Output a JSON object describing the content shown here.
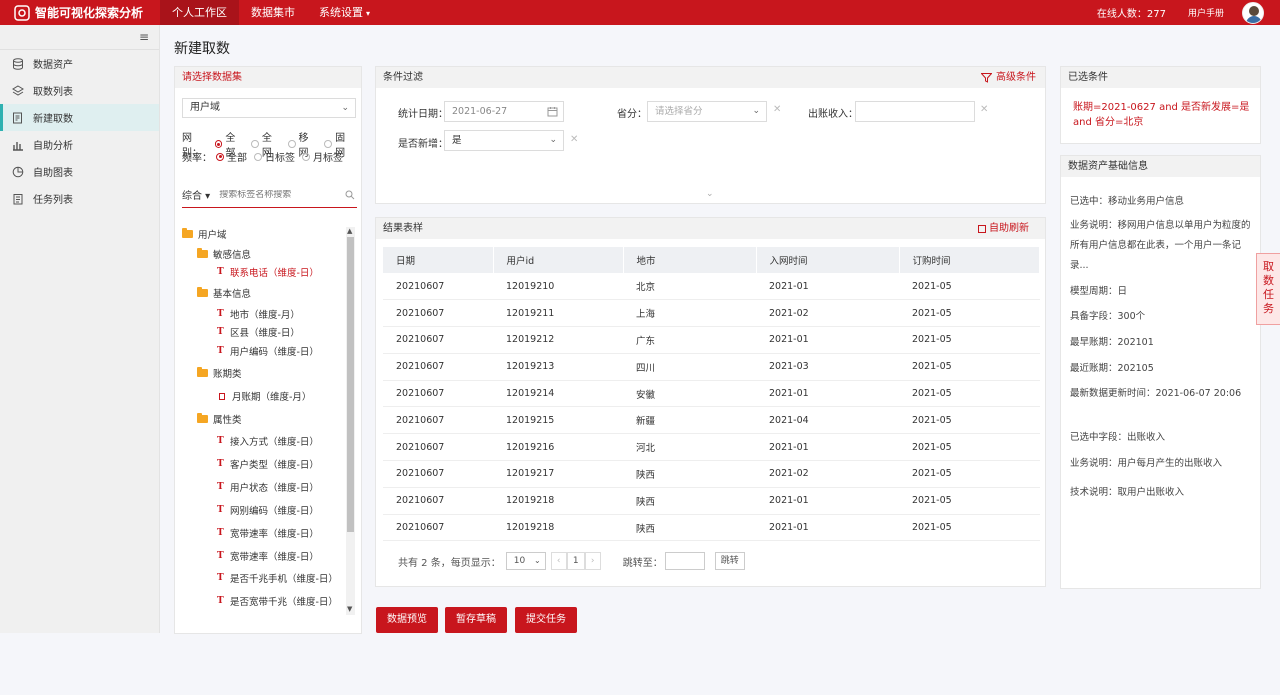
{
  "app": {
    "title": "智能可视化探索分析"
  },
  "topnav": [
    {
      "label": "个人工作区"
    },
    {
      "label": "数据集市"
    },
    {
      "label": "系统设置"
    }
  ],
  "header": {
    "online_label": "在线人数：277",
    "manual": "用户手册"
  },
  "sidebar": {
    "items": [
      {
        "label": "数据资产"
      },
      {
        "label": "取数列表"
      },
      {
        "label": "新建取数"
      },
      {
        "label": "自助分析"
      },
      {
        "label": "自助图表"
      },
      {
        "label": "任务列表"
      }
    ]
  },
  "page": {
    "title": "新建取数"
  },
  "dataset": {
    "title": "请选择数据集",
    "domain": "用户域",
    "net_label": "网别：",
    "net_options": [
      "全部",
      "全网",
      "移网",
      "固网"
    ],
    "freq_label": "频率：",
    "freq_options": [
      "全部",
      "日标签",
      "月标签"
    ],
    "combo": "综合 ▾",
    "search_placeholder": "搜索标签名称搜索",
    "tree": {
      "root": "用户域",
      "n1": "敏感信息",
      "n1a": "联系电话（维度-日）",
      "n2": "基本信息",
      "n2a": "地市（维度-月）",
      "n2b": "区县（维度-日）",
      "n2c": "用户编码（维度-日）",
      "n3": "账期类",
      "n3a": "月账期（维度-月）",
      "n4": "属性类",
      "n4a": "接入方式（维度-日）",
      "n4b": "客户类型（维度-日）",
      "n4c": "用户状态（维度-日）",
      "n4d": "网别编码（维度-日）",
      "n4e": "宽带速率（维度-日）",
      "n4f": "宽带速率（维度-日）",
      "n4g": "是否千兆手机（维度-日）",
      "n4h": "是否宽带千兆（维度-日）"
    }
  },
  "filter": {
    "title": "条件过滤",
    "advanced": "高级条件",
    "date_label": "统计日期：",
    "date_value": "2021-06-27",
    "province_label": "省分：",
    "province_placeholder": "请选择省分",
    "income_label": "出账收入：",
    "income_value": "",
    "new_label": "是否新增：",
    "new_value": "是"
  },
  "result": {
    "title": "结果表样",
    "auto_refresh": "自助刷新",
    "columns": [
      "日期",
      "用户id",
      "地市",
      "入网时间",
      "订购时间"
    ],
    "rows": [
      [
        "20210607",
        "12019210",
        "北京",
        "2021-01",
        "2021-05"
      ],
      [
        "20210607",
        "12019211",
        "上海",
        "2021-02",
        "2021-05"
      ],
      [
        "20210607",
        "12019212",
        "广东",
        "2021-01",
        "2021-05"
      ],
      [
        "20210607",
        "12019213",
        "四川",
        "2021-03",
        "2021-05"
      ],
      [
        "20210607",
        "12019214",
        "安徽",
        "2021-01",
        "2021-05"
      ],
      [
        "20210607",
        "12019215",
        "新疆",
        "2021-04",
        "2021-05"
      ],
      [
        "20210607",
        "12019216",
        "河北",
        "2021-01",
        "2021-05"
      ],
      [
        "20210607",
        "12019217",
        "陕西",
        "2021-02",
        "2021-05"
      ],
      [
        "20210607",
        "12019218",
        "陕西",
        "2021-01",
        "2021-05"
      ],
      [
        "20210607",
        "12019218",
        "陕西",
        "2021-01",
        "2021-05"
      ]
    ],
    "pager": {
      "total": "共有 2 条，每页显示：",
      "page_size": "10",
      "page": "1",
      "jump_label": "跳转至：",
      "go": "跳转"
    }
  },
  "actions": {
    "preview": "数据预览",
    "draft": "暂存草稿",
    "submit": "提交任务"
  },
  "selected": {
    "title": "已选条件",
    "text": "账期=2021-0627 and 是否新发展=是 and 省分=北京"
  },
  "asset_info": {
    "title": "数据资产基础信息",
    "selected": "已选中：移动业务用户信息",
    "desc": "业务说明：移网用户信息以单用户为粒度的所有用户信息都在此表，一个用户一条记录...",
    "cycle": "模型周期：日",
    "fields": "具备字段：300个",
    "earliest": "最早账期：202101",
    "latest": "最近账期：202105",
    "updated": "最新数据更新时间：2021-06-07 20:06",
    "field_selected": "已选中字段：出账收入",
    "field_desc": "业务说明：用户每月产生的出账收入",
    "tech_desc": "技术说明：取用户出账收入"
  },
  "side_tab": "取数任务",
  "colors": {
    "brand": "#c8161d",
    "accent": "#2eb1b1"
  }
}
